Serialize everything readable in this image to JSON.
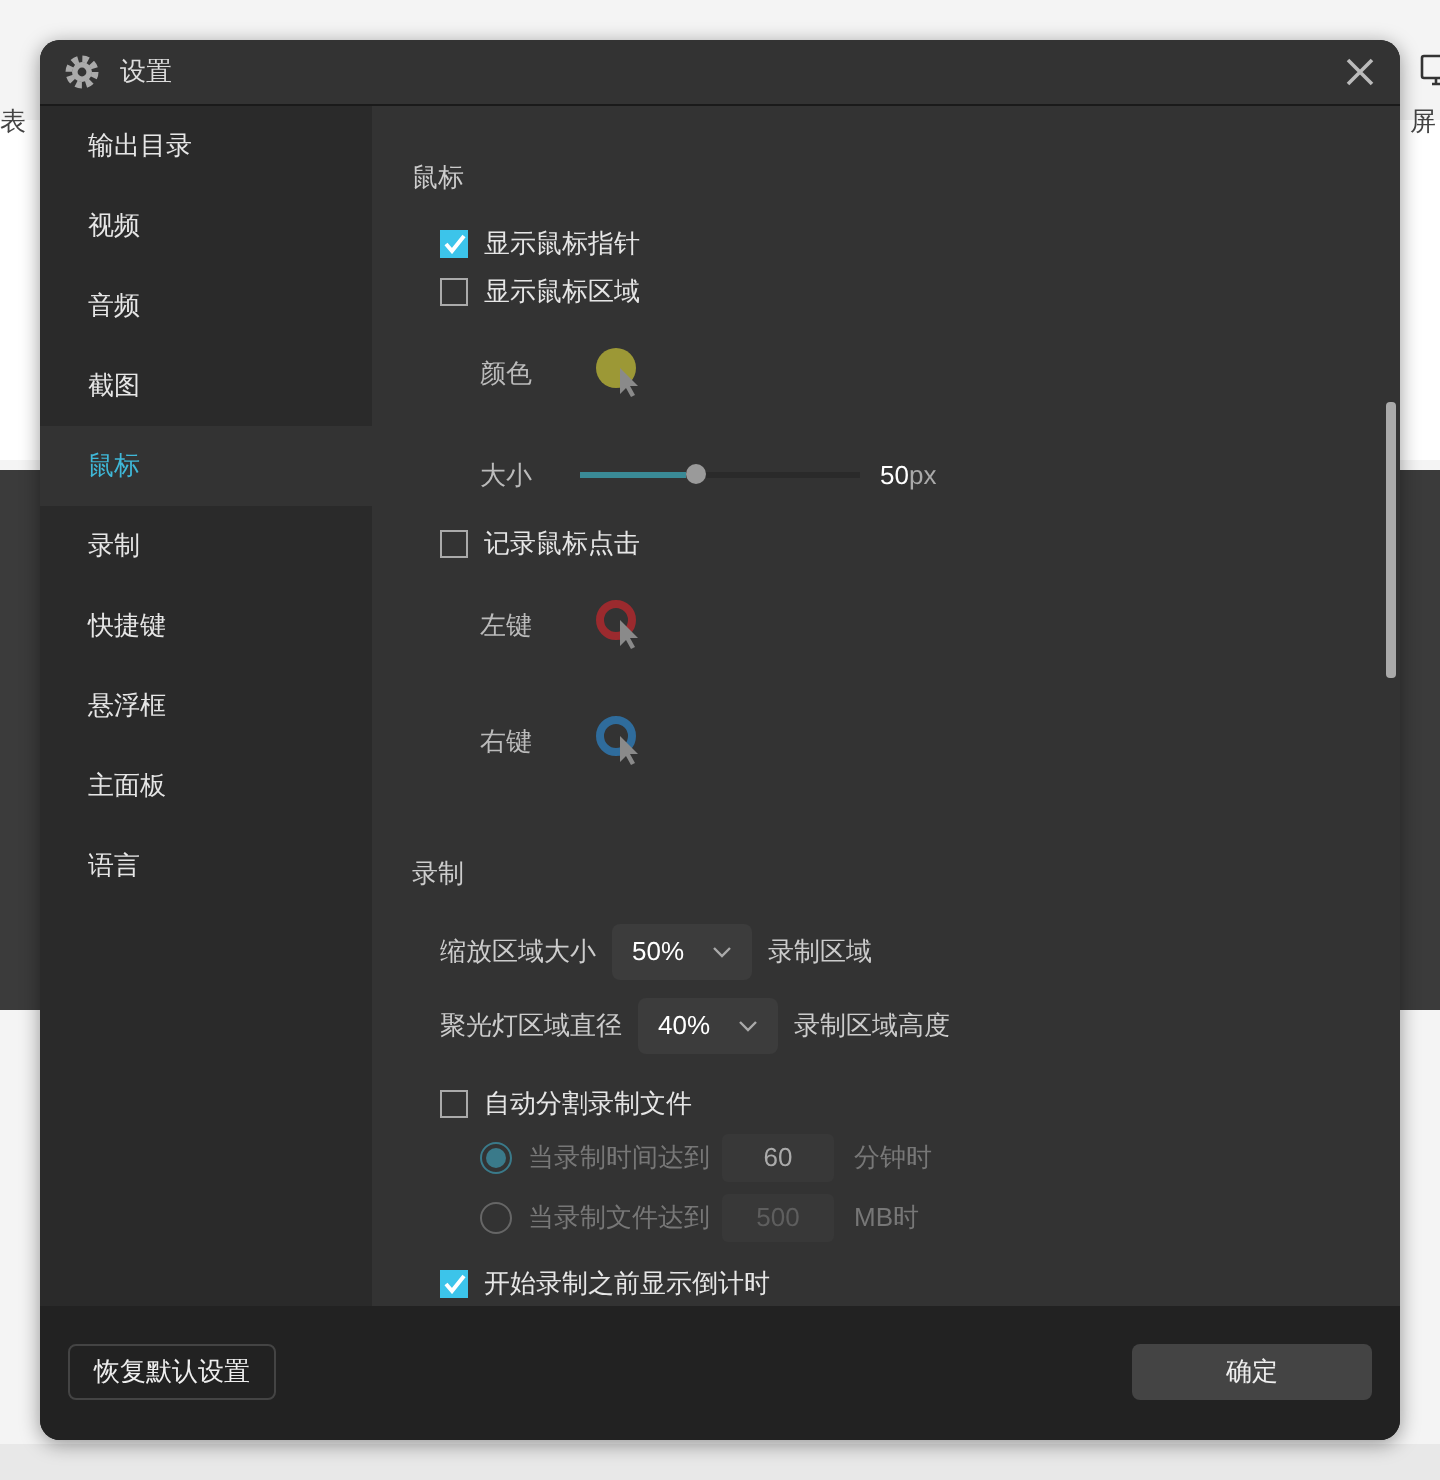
{
  "background_app": {
    "left_label": "表",
    "right_label": "屏"
  },
  "dialog": {
    "title": "设置"
  },
  "sidebar": {
    "items": [
      {
        "label": "输出目录",
        "selected": false
      },
      {
        "label": "视频",
        "selected": false
      },
      {
        "label": "音频",
        "selected": false
      },
      {
        "label": "截图",
        "selected": false
      },
      {
        "label": "鼠标",
        "selected": true
      },
      {
        "label": "录制",
        "selected": false
      },
      {
        "label": "快捷键",
        "selected": false
      },
      {
        "label": "悬浮框",
        "selected": false
      },
      {
        "label": "主面板",
        "selected": false
      },
      {
        "label": "语言",
        "selected": false
      }
    ]
  },
  "sections": [
    {
      "title": "鼠标",
      "rows": [
        {
          "kind": "checkbox",
          "label": "显示鼠标指针",
          "checked": true
        },
        {
          "kind": "checkbox",
          "label": "显示鼠标区域",
          "checked": false
        },
        {
          "kind": "swatch",
          "label": "颜色",
          "color": "#9c9836"
        },
        {
          "kind": "slider",
          "label": "大小",
          "level": 0.38,
          "value": "50",
          "unit": "px"
        },
        {
          "kind": "checkbox",
          "label": "记录鼠标点击",
          "checked": false
        },
        {
          "kind": "ring",
          "label": "左键",
          "color": "#9b2a2e"
        },
        {
          "kind": "ring",
          "label": "右键",
          "color": "#2f6c9c"
        }
      ]
    },
    {
      "title": "录制",
      "rows": [
        {
          "kind": "dropdown",
          "label": "缩放区域大小",
          "value": "50%",
          "suffix": "录制区域"
        },
        {
          "kind": "dropdown",
          "label": "聚光灯区域直径",
          "value": "40%",
          "suffix": "录制区域高度"
        },
        {
          "kind": "checkbox",
          "label": "自动分割录制文件",
          "checked": false
        },
        {
          "kind": "radio",
          "label": "当录制时间达到",
          "value": "60",
          "unit": "分钟时",
          "selected": true,
          "disabled": true
        },
        {
          "kind": "radio",
          "label": "当录制文件达到",
          "placeholder": "500",
          "unit": "MB时",
          "selected": false,
          "disabled": true
        },
        {
          "kind": "checkbox",
          "label": "开始录制之前显示倒计时",
          "checked": true
        }
      ]
    }
  ],
  "footer": {
    "reset_button": "恢复默认设置",
    "ok_button": "确定"
  }
}
